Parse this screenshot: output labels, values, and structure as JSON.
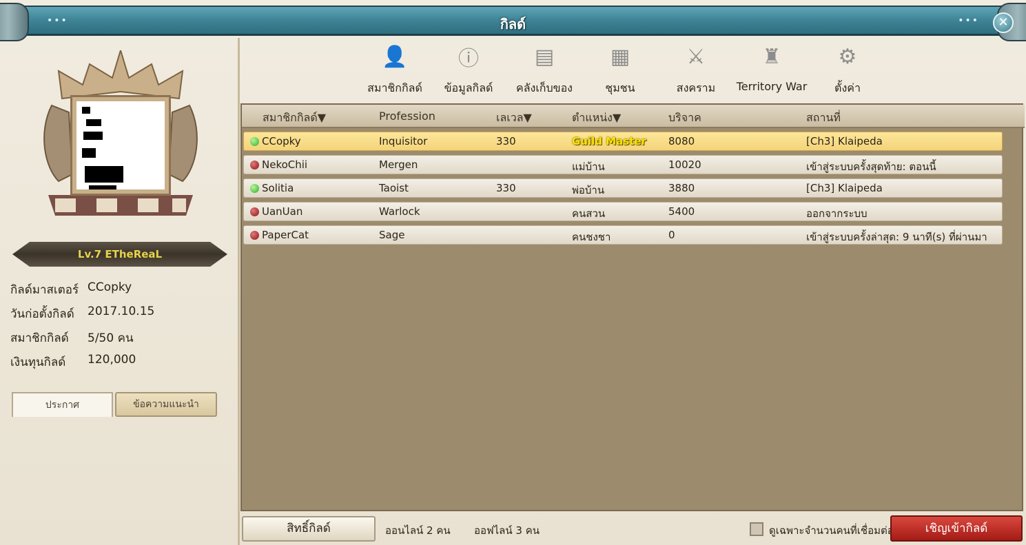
{
  "window": {
    "title": "กิลด์",
    "dots_left": "•••",
    "dots_right": "•••",
    "close_glyph": "✕"
  },
  "guild": {
    "name_banner": "Lv.7 ETheReaL",
    "info": [
      {
        "label": "กิลด์มาสเตอร์",
        "value": "CCopky"
      },
      {
        "label": "วันก่อตั้งกิลด์",
        "value": "2017.10.15"
      },
      {
        "label": "สมาชิกกิลด์",
        "value": "5/50 คน"
      },
      {
        "label": "เงินทุนกิลด์",
        "value": "120,000"
      }
    ],
    "tab_announce": "ประกาศ",
    "tab_intro": "ข้อความแนะนำ"
  },
  "toolbar": [
    {
      "id": "members",
      "label": "สมาชิกกิลด์",
      "icon": "person-icon",
      "glyph": "👤"
    },
    {
      "id": "info",
      "label": "ข้อมูลกิลด์",
      "icon": "info-icon",
      "glyph": "ⓘ"
    },
    {
      "id": "storage",
      "label": "คลังเก็บของ",
      "icon": "chest-icon",
      "glyph": "▤"
    },
    {
      "id": "community",
      "label": "ชุมชน",
      "icon": "board-icon",
      "glyph": "▦"
    },
    {
      "id": "war",
      "label": "สงคราม",
      "icon": "crossed-swords-icon",
      "glyph": "⚔"
    },
    {
      "id": "territory",
      "label": "Territory War",
      "icon": "castle-icon",
      "glyph": "♜"
    },
    {
      "id": "settings",
      "label": "ตั้งค่า",
      "icon": "gear-icon",
      "glyph": "⚙"
    }
  ],
  "table": {
    "headers": [
      "สมาชิกกิลด์▼",
      "Profession",
      "เลเวล▼",
      "ตำแหน่ง▼",
      "บริจาค",
      "สถานที่"
    ],
    "rows": [
      {
        "online": true,
        "name": "CCopky",
        "profession": "Inquisitor",
        "level": "330",
        "rank": "Guild Master",
        "donation": "8080",
        "location": "[Ch3] Klaipeda",
        "selected": true
      },
      {
        "online": false,
        "name": "NekoChii",
        "profession": "Mergen",
        "level": "",
        "rank": "แม่บ้าน",
        "donation": "10020",
        "location": "เข้าสู่ระบบครั้งสุดท้าย: ตอนนี้"
      },
      {
        "online": true,
        "name": "Solitia",
        "profession": "Taoist",
        "level": "330",
        "rank": "พ่อบ้าน",
        "donation": "3880",
        "location": "[Ch3] Klaipeda"
      },
      {
        "online": false,
        "name": "UanUan",
        "profession": "Warlock",
        "level": "",
        "rank": "คนสวน",
        "donation": "5400",
        "location": "ออกจากระบบ"
      },
      {
        "online": false,
        "name": "PaperCat",
        "profession": "Sage",
        "level": "",
        "rank": "คนชงชา",
        "donation": "0",
        "location": "เข้าสู่ระบบครั้งล่าสุด: 9 นาที(s) ที่ผ่านมา"
      }
    ]
  },
  "footer": {
    "rights_button": "สิทธิ์กิลด์",
    "online_text": "ออนไลน์ 2 คน",
    "offline_text": "ออฟไลน์ 3 คน",
    "checkbox_label": "ดูเฉพาะจำนวนคนที่เชื่อมต่อ",
    "invite_button": "เชิญเข้ากิลด์"
  }
}
